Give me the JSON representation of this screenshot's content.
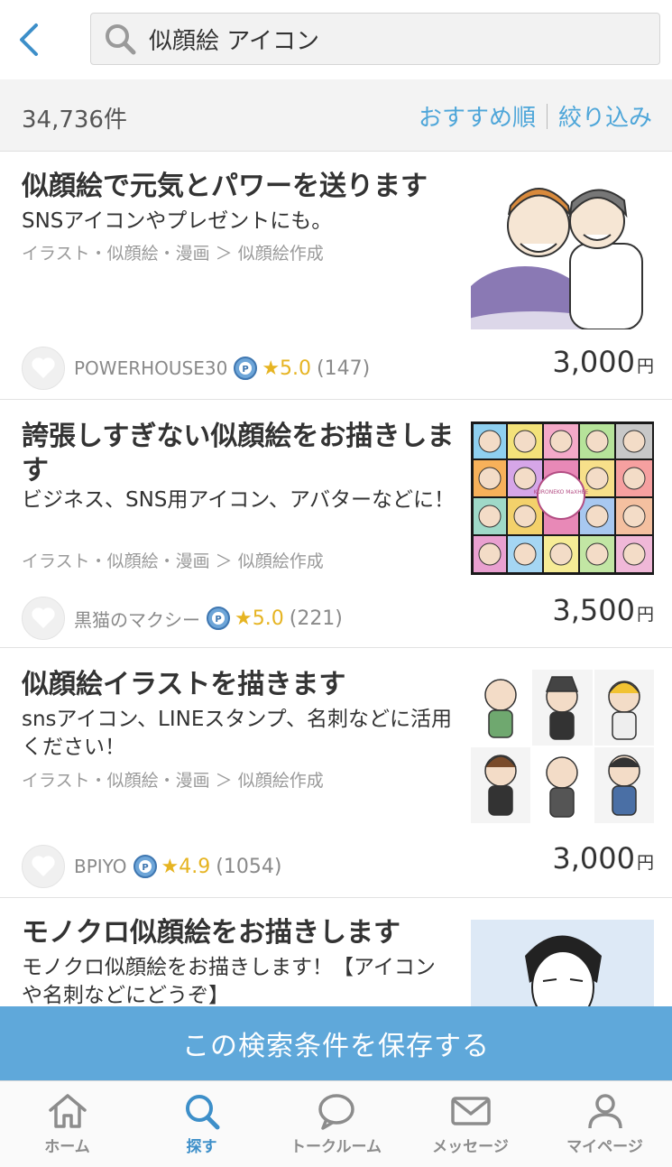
{
  "search": {
    "query": "似顔絵 アイコン"
  },
  "results": {
    "count": "34,736件",
    "sort_label": "おすすめ順",
    "filter_label": "絞り込み"
  },
  "listings": [
    {
      "title": "似顔絵で元気とパワーを送ります",
      "description": "SNSアイコンやプレゼントにも。",
      "category": "イラスト・似顔絵・漫画 ＞ 似顔絵作成",
      "seller": "POWERHOUSE30",
      "rating": "5.0",
      "reviews": "(147)",
      "price": "3,000",
      "yen": "円"
    },
    {
      "title": "誇張しすぎない似顔絵をお描きします",
      "description": "ビジネス、SNS用アイコン、アバターなどに！",
      "category": "イラスト・似顔絵・漫画 ＞ 似顔絵作成",
      "seller": "黒猫のマクシー",
      "rating": "5.0",
      "reviews": "(221)",
      "price": "3,500",
      "yen": "円",
      "thumb_text": "KURONEKO MaXHEE"
    },
    {
      "title": "似顔絵イラストを描きます",
      "description": "snsアイコン、LINEスタンプ、名刺などに活用ください！",
      "category": "イラスト・似顔絵・漫画 ＞ 似顔絵作成",
      "seller": "BPIYO",
      "rating": "4.9",
      "reviews": "(1054)",
      "price": "3,000",
      "yen": "円"
    },
    {
      "title": "モノクロ似顔絵をお描きします",
      "description": "モノクロ似顔絵をお描きします！【アイコンや名刺などにどうぞ】"
    }
  ],
  "save_banner": "この検索条件を保存する",
  "tabs": [
    {
      "label": "ホーム",
      "icon": "home-icon"
    },
    {
      "label": "探す",
      "icon": "search-icon"
    },
    {
      "label": "トークルーム",
      "icon": "chat-bubble-icon"
    },
    {
      "label": "メッセージ",
      "icon": "mail-icon"
    },
    {
      "label": "マイページ",
      "icon": "user-icon"
    }
  ],
  "colors": {
    "accent": "#4ea6d9",
    "banner": "#5fa8da",
    "star": "#e6b422",
    "active_tab": "#3d8fc9"
  }
}
